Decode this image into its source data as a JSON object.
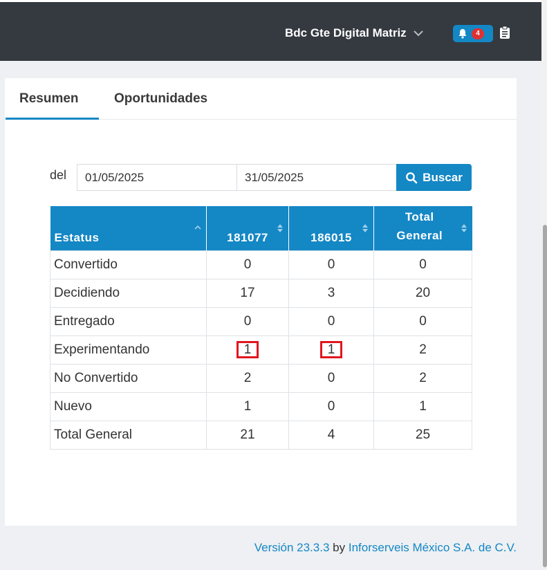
{
  "header": {
    "user_name": "Bdc Gte Digital Matriz",
    "notification_count": "4",
    "icons": [
      "chevron-down-icon",
      "bell-icon",
      "clipboard-icon"
    ]
  },
  "tabs": [
    {
      "label": "Resumen",
      "active": true
    },
    {
      "label": "Oportunidades",
      "active": false
    }
  ],
  "filter": {
    "del_label": "del",
    "date_from": "01/05/2025",
    "date_to": "31/05/2025",
    "search_label": "Buscar"
  },
  "table": {
    "columns": [
      "Estatus",
      "181077",
      "186015",
      "Total General"
    ],
    "rows": [
      [
        "Convertido",
        "0",
        "0",
        "0"
      ],
      [
        "Decidiendo",
        "17",
        "3",
        "20"
      ],
      [
        "Entregado",
        "0",
        "0",
        "0"
      ],
      [
        "Experimentando",
        "1",
        "1",
        "2"
      ],
      [
        "No Convertido",
        "2",
        "0",
        "2"
      ],
      [
        "Nuevo",
        "1",
        "0",
        "1"
      ],
      [
        "Total General",
        "21",
        "4",
        "25"
      ]
    ]
  },
  "footer": {
    "version": "Versión 23.3.3",
    "by": "by",
    "company": "Inforserveis México S.A. de C.V."
  },
  "colors": {
    "topbar": "#343a40",
    "accent": "#1487c5",
    "badge": "#e03131",
    "highlight": "#e0161f"
  }
}
